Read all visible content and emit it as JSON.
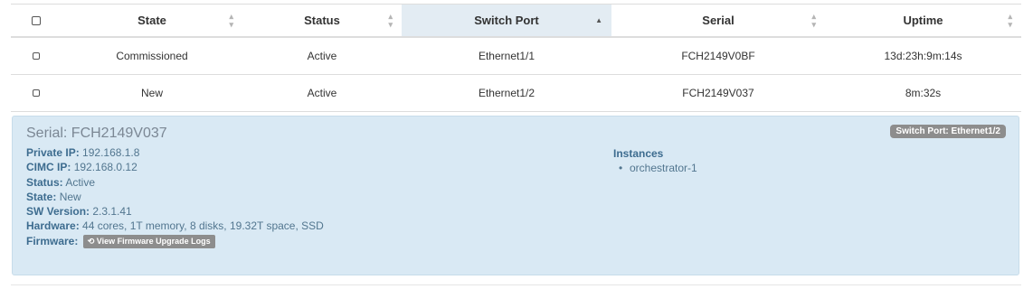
{
  "table": {
    "columns": [
      {
        "label": "",
        "sortable": false
      },
      {
        "label": "State",
        "sortable": true
      },
      {
        "label": "Status",
        "sortable": true
      },
      {
        "label": "Switch Port",
        "sortable": true,
        "sorted": "asc"
      },
      {
        "label": "Serial",
        "sortable": true
      },
      {
        "label": "Uptime",
        "sortable": true
      }
    ],
    "rows": [
      {
        "state": "Commissioned",
        "status": "Active",
        "switch_port": "Ethernet1/1",
        "serial": "FCH2149V0BF",
        "uptime": "13d:23h:9m:14s",
        "checked": false
      },
      {
        "state": "New",
        "status": "Active",
        "switch_port": "Ethernet1/2",
        "serial": "FCH2149V037",
        "uptime": "8m:32s",
        "checked": false
      }
    ]
  },
  "icons": {
    "sort": "sort-both-icon",
    "sort_asc": "sort-asc-icon",
    "history": "history-icon",
    "bullet": "bullet-icon"
  },
  "detail": {
    "title": "Serial: FCH2149V037",
    "badge": "Switch Port: Ethernet1/2",
    "properties": [
      {
        "label": "Private IP:",
        "value": "192.168.1.8"
      },
      {
        "label": "CIMC IP:",
        "value": "192.168.0.12"
      },
      {
        "label": "Status:",
        "value": "Active"
      },
      {
        "label": "State:",
        "value": "New"
      },
      {
        "label": "SW Version:",
        "value": "2.3.1.41"
      },
      {
        "label": "Hardware:",
        "value": "44 cores, 1T memory, 8 disks, 19.32T space, SSD"
      }
    ],
    "firmware": {
      "label": "Firmware:",
      "button": "View Firmware Upgrade Logs"
    },
    "instances": {
      "title": "Instances",
      "items": [
        "orchestrator-1"
      ]
    }
  },
  "colors": {
    "panel_bg": "#d9e9f4",
    "sorted_header_bg": "#e3ecf3",
    "label_blue": "#3d6c8f",
    "badge_gray": "#8d8d8d"
  }
}
